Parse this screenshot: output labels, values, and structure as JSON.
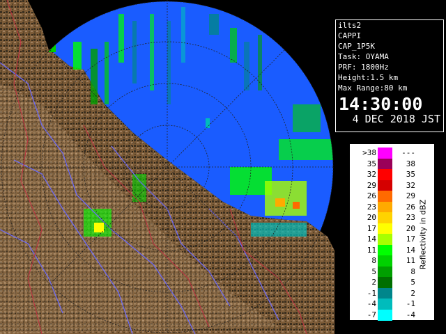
{
  "info_panel": {
    "station": "ilts2",
    "product": "CAPPI",
    "product_code": "CAP_1P5K",
    "task": "Task: OYAMA",
    "prf": "PRF: 1800Hz",
    "height": "Height:1.5 km",
    "max_range": "Max Range:80 km",
    "time": "14:30:00",
    "date": "4 DEC 2018 JST"
  },
  "legend": {
    "unit_label": "Reflectivity in dBZ",
    "rows": [
      {
        "lo": ">38",
        "hi": "---",
        "color": "#ff00ff"
      },
      {
        "lo": "35",
        "hi": "38",
        "color": "#9a0059"
      },
      {
        "lo": "32",
        "hi": "35",
        "color": "#ff0000"
      },
      {
        "lo": "29",
        "hi": "32",
        "color": "#d50000"
      },
      {
        "lo": "26",
        "hi": "29",
        "color": "#ff6a00"
      },
      {
        "lo": "23",
        "hi": "26",
        "color": "#ffaa00"
      },
      {
        "lo": "20",
        "hi": "23",
        "color": "#ffd300"
      },
      {
        "lo": "17",
        "hi": "20",
        "color": "#ffff00"
      },
      {
        "lo": "14",
        "hi": "17",
        "color": "#a8ff00"
      },
      {
        "lo": "11",
        "hi": "14",
        "color": "#00ff00"
      },
      {
        "lo": "8",
        "hi": "11",
        "color": "#00d200"
      },
      {
        "lo": "5",
        "hi": "8",
        "color": "#009f00"
      },
      {
        "lo": "2",
        "hi": "5",
        "color": "#006f00"
      },
      {
        "lo": "-1",
        "hi": "2",
        "color": "#00868b"
      },
      {
        "lo": "-4",
        "hi": "-1",
        "color": "#00bcbc"
      },
      {
        "lo": "-7",
        "hi": "-4",
        "color": "#00ffff"
      }
    ]
  },
  "colors": {
    "radar_background": "#1a5cff",
    "land": "#7a5a36",
    "land_dark": "#3a2f1f",
    "rivers": "#6a6aff",
    "boundaries": "#c03040",
    "range_rings": "#222222"
  }
}
